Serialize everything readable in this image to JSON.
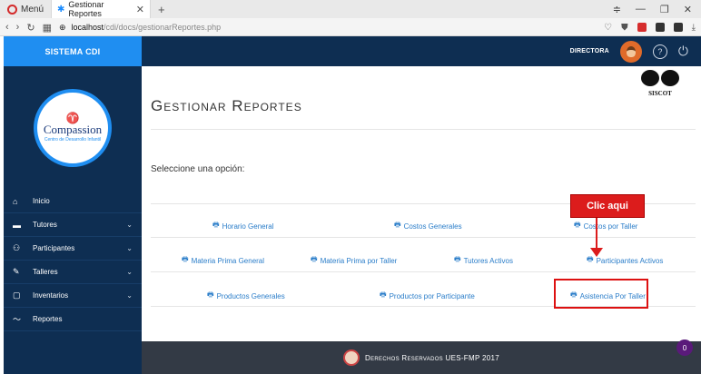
{
  "browser": {
    "menu_label": "Menú",
    "tab_title": "Gestionar Reportes",
    "address_host": "localhost",
    "address_path": "/cdi/docs/gestionarReportes.php"
  },
  "sidebar": {
    "brand": "SISTEMA CDI",
    "logo_word": "Compassion",
    "logo_tag": "Centro de Desarrollo Infantil",
    "items": [
      {
        "label": "Inicio",
        "icon": "home-icon",
        "has_chevron": false
      },
      {
        "label": "Tutores",
        "icon": "briefcase-icon",
        "has_chevron": true
      },
      {
        "label": "Participantes",
        "icon": "people-icon",
        "has_chevron": true
      },
      {
        "label": "Talleres",
        "icon": "wrench-icon",
        "has_chevron": true
      },
      {
        "label": "Inventarios",
        "icon": "clipboard-icon",
        "has_chevron": true
      },
      {
        "label": "Reportes",
        "icon": "chart-line-icon",
        "has_chevron": false
      }
    ]
  },
  "topbar": {
    "role": "DIRECTORA",
    "help_glyph": "?",
    "power_glyph": "⏻"
  },
  "main": {
    "siscot": "SISCOT",
    "title": "Gestionar Reportes",
    "prompt": "Seleccione una opción:",
    "reports_row1": [
      "Horario General",
      "Costos Generales",
      "Costos por Taller"
    ],
    "reports_row2": [
      "Materia Prima General",
      "Materia Prima por Taller",
      "Tutores Activos",
      "Participantes Activos"
    ],
    "reports_row3": [
      "Productos Generales",
      "Productos por Participante",
      "Asistencia Por Taller"
    ]
  },
  "annotation": {
    "callout": "Clic aqui"
  },
  "footer": {
    "text": "Derechos Reservados UES-FMP 2017"
  },
  "badge": "0",
  "colors": {
    "brand_blue": "#1f8ef1",
    "sidebar_navy": "#0e2e52",
    "link_blue": "#2a7dc9",
    "callout_red": "#dc1c1c"
  }
}
